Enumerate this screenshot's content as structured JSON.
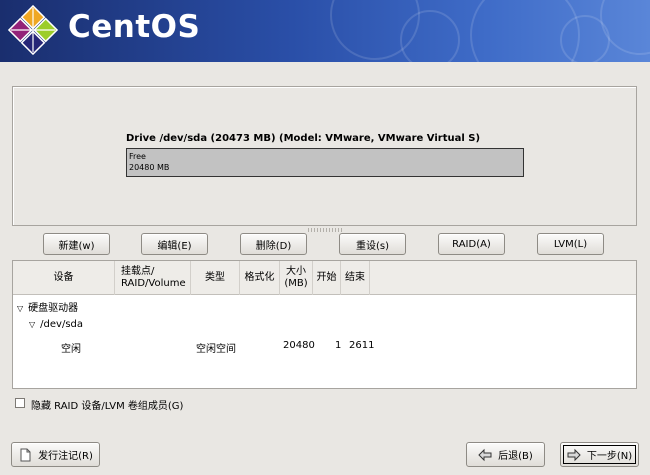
{
  "banner": {
    "logo_text": "CentOS"
  },
  "drive": {
    "title": "Drive /dev/sda (20473 MB) (Model: VMware, VMware Virtual S)",
    "segment_label": "Free",
    "segment_size": "20480 MB"
  },
  "toolbar": {
    "new_label": "新建(w)",
    "edit_label": "编辑(E)",
    "delete_label": "删除(D)",
    "reset_label": "重设(s)",
    "raid_label": "RAID(A)",
    "lvm_label": "LVM(L)"
  },
  "table": {
    "columns": [
      "设备",
      "挂载点/\nRAID/Volume",
      "类型",
      "格式化",
      "大小\n(MB)",
      "开始",
      "结束"
    ],
    "rows": {
      "group": "硬盘驱动器",
      "drive": "/dev/sda",
      "free": {
        "device": "空闲",
        "type": "空闲空间",
        "size": "20480",
        "start": "1",
        "end": "2611"
      }
    }
  },
  "options": {
    "hide_raid_lvm": "隐藏 RAID 设备/LVM 卷组成员(G)",
    "hide_raid_lvm_checked": false
  },
  "footer": {
    "release_notes_label": "发行注记(R)",
    "back_label": "后退(B)",
    "next_label": "下一步(N)"
  }
}
